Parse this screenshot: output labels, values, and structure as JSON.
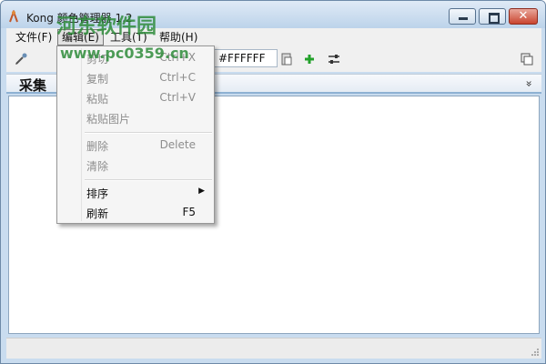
{
  "window": {
    "title": "Kong 颜色管理器 1.2",
    "close_glyph": "✕"
  },
  "menubar": {
    "items": [
      "文件(F)",
      "编辑(E)",
      "工具(T)",
      "帮助(H)"
    ],
    "active_index": 1
  },
  "toolbar": {
    "color_value": "#FFFFFF"
  },
  "panel": {
    "title": "采集",
    "chevron": "»"
  },
  "dropdown": {
    "items": [
      {
        "label": "剪切",
        "shortcut": "Ctrl+X",
        "enabled": false
      },
      {
        "label": "复制",
        "shortcut": "Ctrl+C",
        "enabled": false
      },
      {
        "label": "粘贴",
        "shortcut": "Ctrl+V",
        "enabled": false
      },
      {
        "label": "粘贴图片",
        "shortcut": "",
        "enabled": false
      },
      {
        "label": "删除",
        "shortcut": "Delete",
        "enabled": false
      },
      {
        "label": "清除",
        "shortcut": "",
        "enabled": false
      },
      {
        "label": "排序",
        "shortcut": "",
        "enabled": true,
        "submenu_arrow": "▶"
      },
      {
        "label": "刷新",
        "shortcut": "F5",
        "enabled": true
      }
    ]
  },
  "watermark": {
    "site": "河东软件园",
    "url": "www.pc0359.cn"
  },
  "colors": {
    "title_bg": "#c9dcef",
    "menu_bg": "#f0f0f0",
    "accent": "#8eb1d3",
    "watermark": "#2e8b3a"
  }
}
